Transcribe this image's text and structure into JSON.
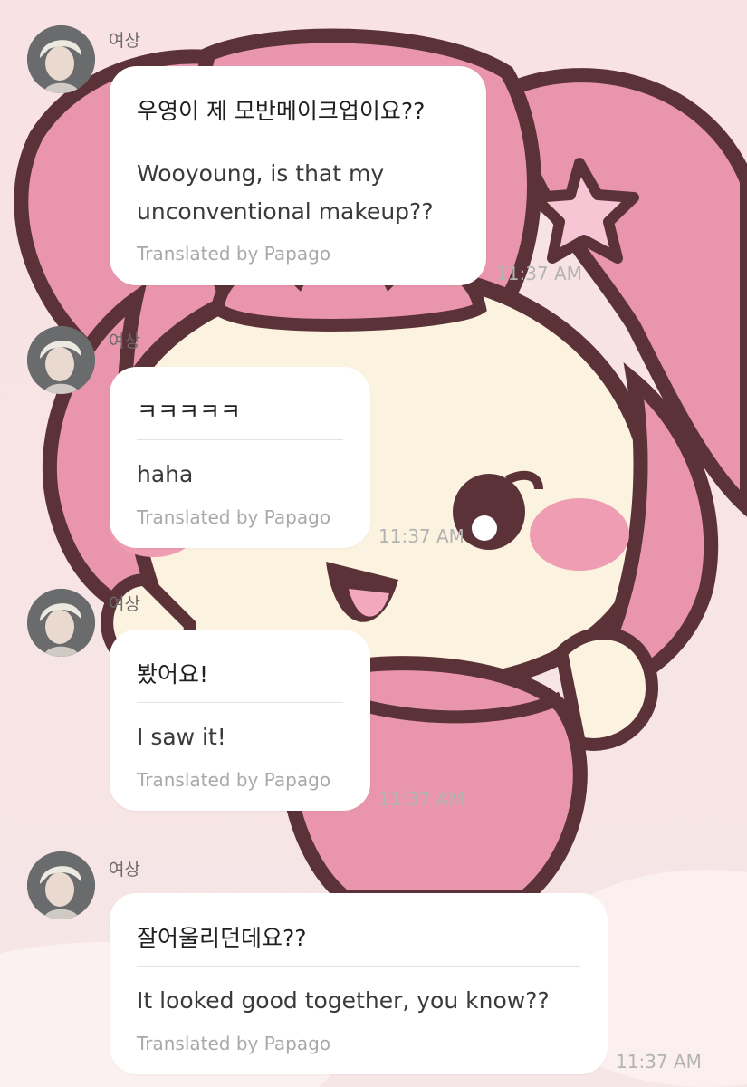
{
  "chat": {
    "messages": [
      {
        "sender": "여상",
        "original": "우영이 제 모반메이크업이요??",
        "translation": "Wooyoung, is that my unconventional makeup??",
        "credit": "Translated by Papago",
        "time": "11:37 AM"
      },
      {
        "sender": "여상",
        "original": "ㅋㅋㅋㅋㅋ",
        "translation": "haha",
        "credit": "Translated by Papago",
        "time": "11:37 AM"
      },
      {
        "sender": "여상",
        "original": "봤어요!",
        "translation": "I saw it!",
        "credit": "Translated by Papago",
        "time": "11:37 AM"
      },
      {
        "sender": "여상",
        "original": "잘어울리던데요??",
        "translation": "It looked good together, you know??",
        "credit": "Translated by Papago",
        "time": "11:37 AM"
      }
    ]
  },
  "colors": {
    "wallpaper_pink": "#e995ad",
    "wallpaper_outline": "#5b3238",
    "wallpaper_cream": "#fbf2df",
    "bubble": "#ffffff",
    "timestamp": "#b3b3b3"
  }
}
